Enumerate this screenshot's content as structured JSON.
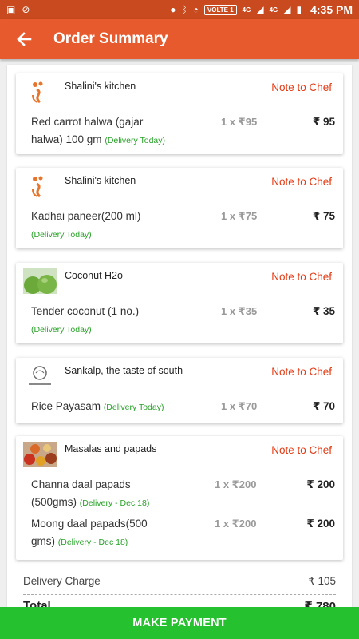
{
  "status_bar": {
    "network_badge": "VOLTE 1",
    "signal_1": "4G",
    "signal_2": "4G",
    "time": "4:35 PM"
  },
  "app_bar": {
    "title": "Order Summary"
  },
  "orders": [
    {
      "shop": "Shalini's kitchen",
      "note_label": "Note to Chef",
      "logo_icon": "chef-logo-icon",
      "items": [
        {
          "name_line1": "Red carrot halwa (gajar",
          "name_line2": "halwa) 100 gm",
          "delivery": "(Delivery Today)",
          "qty": "1 x ₹95",
          "price": "₹ 95"
        }
      ]
    },
    {
      "shop": "Shalini's kitchen",
      "note_label": "Note to Chef",
      "logo_icon": "chef-logo-icon",
      "items": [
        {
          "name": "Kadhai paneer(200 ml)",
          "delivery": "(Delivery Today)",
          "qty": "1 x ₹75",
          "price": "₹ 75"
        }
      ]
    },
    {
      "shop": "Coconut H2o",
      "note_label": "Note to Chef",
      "logo_icon": "coconut-image",
      "items": [
        {
          "name": "Tender coconut (1 no.)",
          "delivery": "(Delivery Today)",
          "qty": "1 x ₹35",
          "price": "₹ 35"
        }
      ]
    },
    {
      "shop": "Sankalp, the taste of south",
      "note_label": "Note to Chef",
      "logo_icon": "sankalp-logo",
      "items": [
        {
          "name": "Rice Payasam",
          "delivery": "(Delivery Today)",
          "qty": "1 x ₹70",
          "price": "₹ 70"
        }
      ]
    },
    {
      "shop": "Masalas and papads",
      "note_label": "Note to Chef",
      "logo_icon": "spices-image",
      "items": [
        {
          "name_line1": "Channa daal papads",
          "name_line2": "(500gms)",
          "delivery": "(Delivery - Dec 18)",
          "qty": "1 x ₹200",
          "price": "₹ 200"
        },
        {
          "name_line1": "Moong daal papads(500",
          "name_line2": "gms)",
          "delivery": "(Delivery - Dec 18)",
          "qty": "1 x ₹200",
          "price": "₹ 200"
        }
      ]
    }
  ],
  "summary": {
    "delivery_label": "Delivery Charge",
    "delivery_value": "₹ 105",
    "total_label": "Total",
    "total_value": "₹ 780"
  },
  "footer": {
    "pay_label": "MAKE PAYMENT"
  },
  "colors": {
    "header": "#e75a2d",
    "status_bar": "#c84a1e",
    "note": "#e53a14",
    "delivery": "#27a127",
    "pay_button": "#26c12e"
  }
}
